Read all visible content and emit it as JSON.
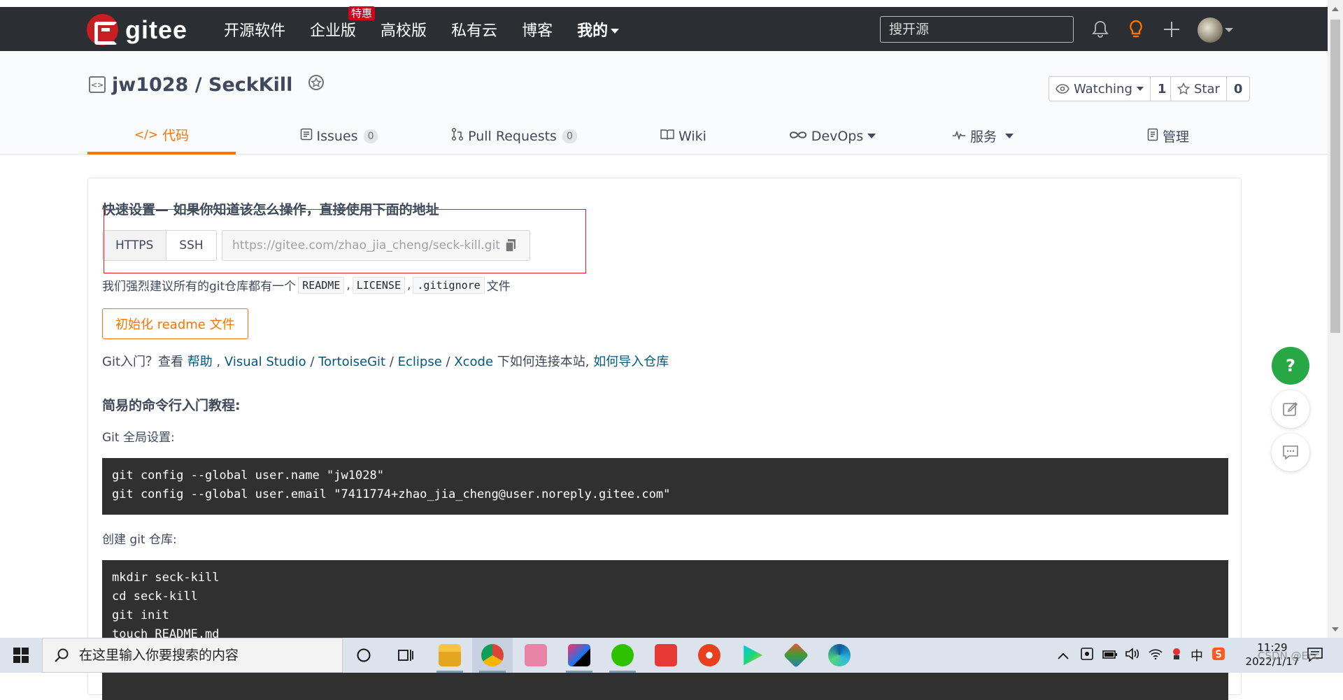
{
  "navbar": {
    "logo_text": "gitee",
    "menu": [
      {
        "label": "开源软件"
      },
      {
        "label": "企业版",
        "badge": "特惠"
      },
      {
        "label": "高校版"
      },
      {
        "label": "私有云"
      },
      {
        "label": "博客"
      },
      {
        "label": "我的"
      }
    ],
    "search_placeholder": "搜开源"
  },
  "repo": {
    "title": "jw1028 / SeckKill",
    "watch_label": "Watching",
    "watch_count": "1",
    "star_label": "Star",
    "star_count": "0",
    "tabs": [
      {
        "label": "代码",
        "icon": "code-icon",
        "active": true
      },
      {
        "label": "Issues",
        "badge": "0",
        "icon": "issues-icon"
      },
      {
        "label": "Pull Requests",
        "badge": "0",
        "icon": "pull-request-icon"
      },
      {
        "label": "Wiki",
        "icon": "book-icon"
      },
      {
        "label": "DevOps",
        "icon": "infinity-icon"
      },
      {
        "label": "服务",
        "icon": "pulse-icon"
      },
      {
        "label": "管理",
        "icon": "clipboard-icon"
      }
    ]
  },
  "quick_setup": {
    "title": "快速设置— 如果你知道该怎么操作，直接使用下面的地址",
    "protocols": [
      "HTTPS",
      "SSH"
    ],
    "url": "https://gitee.com/zhao_jia_cheng/seck-kill.git",
    "suggest_prefix": "我们强烈建议所有的git仓库都有一个",
    "suggest_files": [
      "README",
      "LICENSE",
      ".gitignore"
    ],
    "suggest_suffix": "文件",
    "init_button": "初始化 readme 文件",
    "git_intro": {
      "prefix": "Git入门？查看 ",
      "help": "帮助",
      "vs": "Visual Studio",
      "tortoise": "TortoiseGit",
      "eclipse": "Eclipse",
      "xcode": "Xcode",
      "middle": " 下如何连接本站, ",
      "import": "如何导入仓库"
    },
    "cli_title": "简易的命令行入门教程:",
    "global_label": "Git 全局设置:",
    "global_code": "git config --global user.name \"jw1028\"\ngit config --global user.email \"7411774+zhao_jia_cheng@user.noreply.gitee.com\"",
    "create_label": "创建 git 仓库:",
    "create_code": "mkdir seck-kill\ncd seck-kill\ngit init\ntouch README.md"
  },
  "fab": {
    "help": "?"
  },
  "taskbar": {
    "search_placeholder": "在这里输入你要搜索的内容",
    "ime": "中",
    "time": "11:29",
    "date": "2022/1/17"
  },
  "watermark": "CSDN @Ecc"
}
